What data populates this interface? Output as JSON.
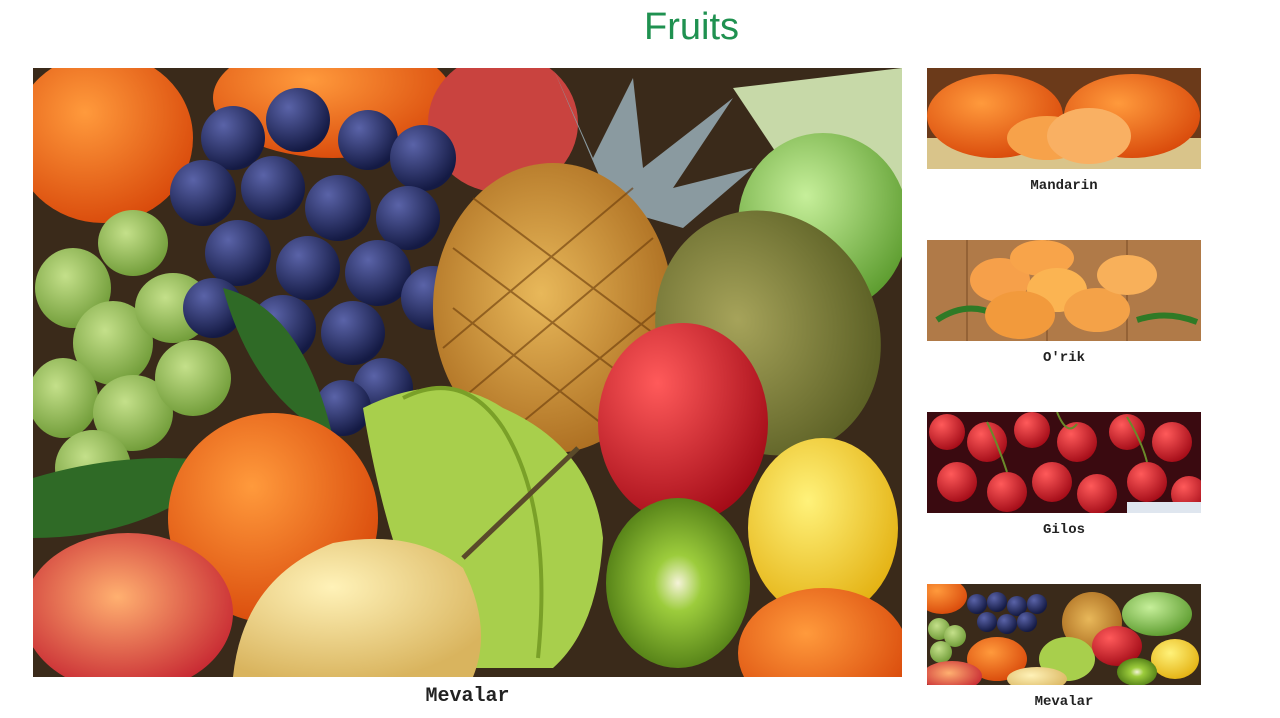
{
  "page": {
    "title": "Fruits"
  },
  "main": {
    "caption": "Mevalar"
  },
  "thumbnails": [
    {
      "caption": "Mandarin"
    },
    {
      "caption": "O'rik"
    },
    {
      "caption": "Gilos"
    },
    {
      "caption": "Mevalar"
    }
  ],
  "colors": {
    "title": "#1f9150",
    "caption_text": "#222222",
    "background": "#ffffff"
  }
}
